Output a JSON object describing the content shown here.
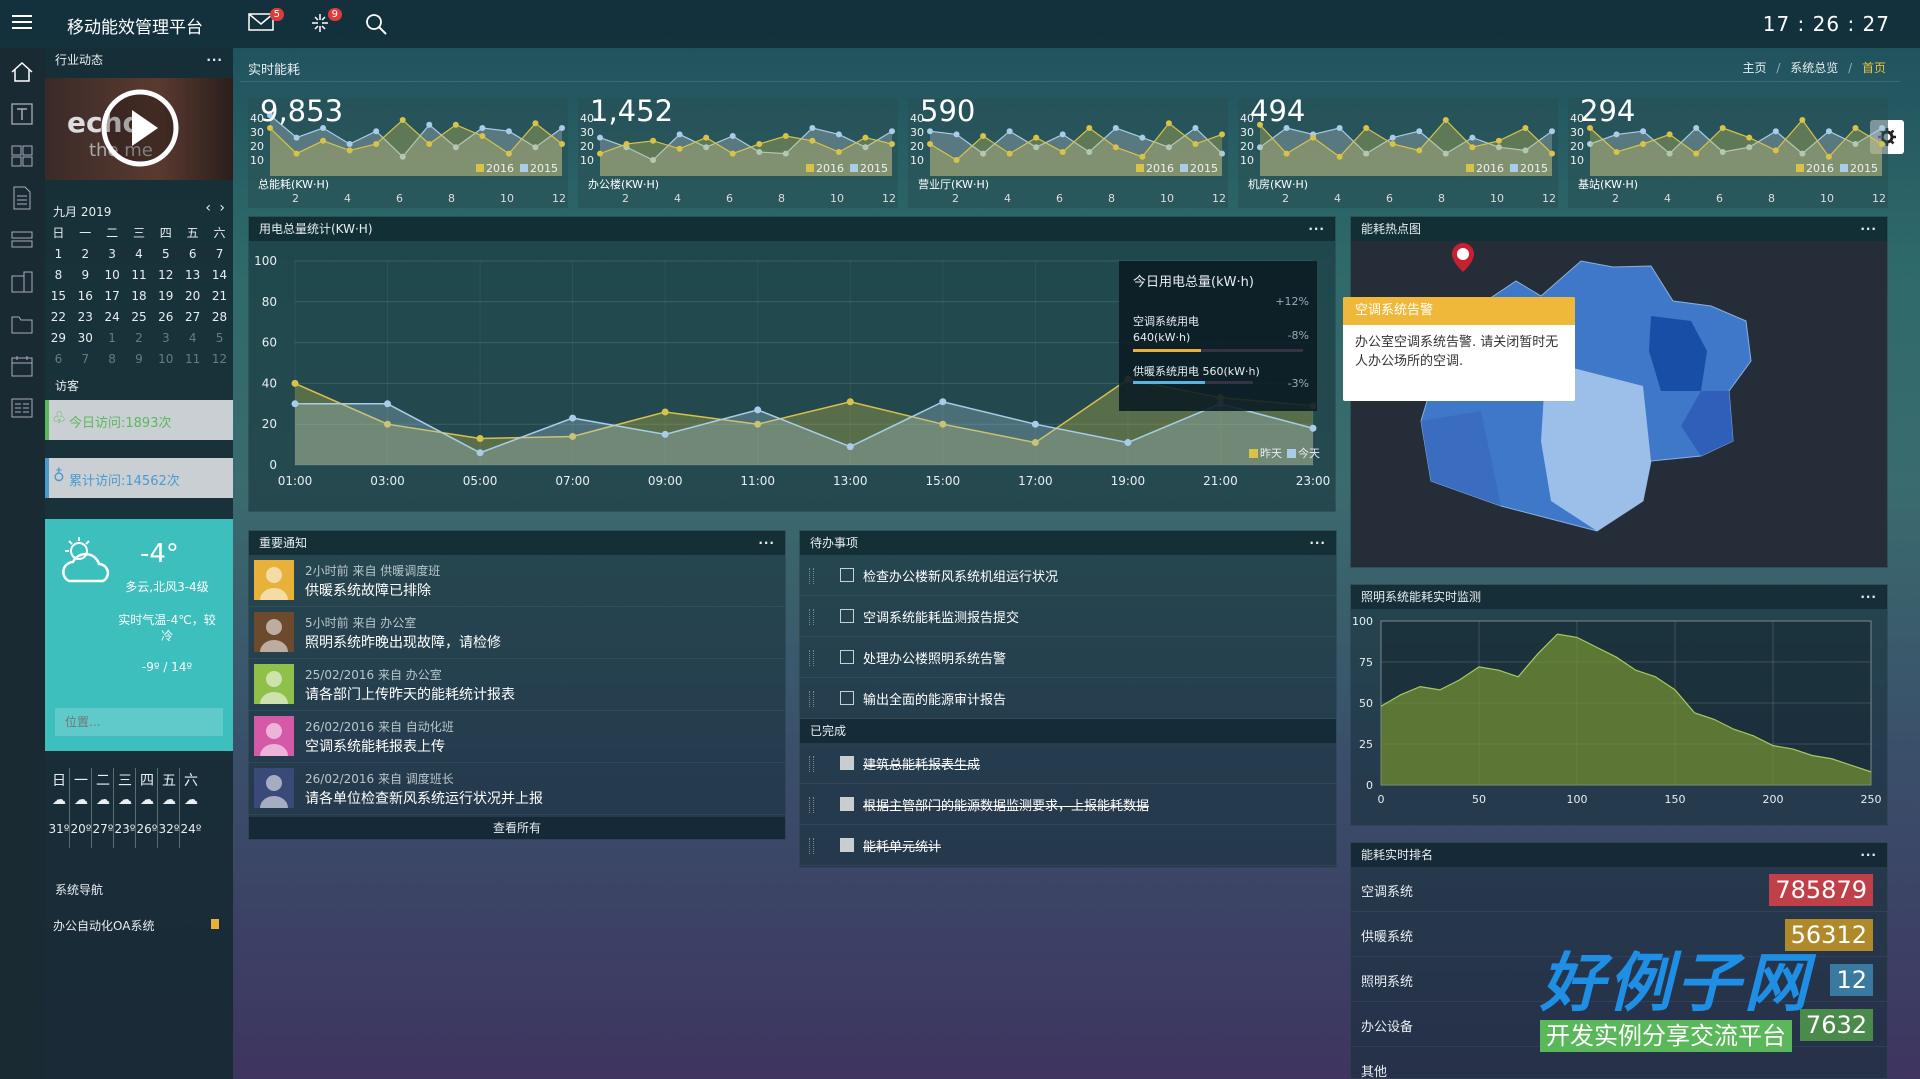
{
  "app": {
    "title": "移动能效管理平台",
    "clock": "17 : 26 : 27",
    "mail_badge": "5",
    "plug_badge": "9"
  },
  "header": {
    "section_title": "实时能耗",
    "breadcrumb": [
      "主页",
      "系统总览",
      "首页"
    ]
  },
  "sidebar": {
    "news_title": "行业动态",
    "video_text": "echo",
    "video_sub": "the me",
    "calendar": {
      "month": "九月 2019",
      "weekdays": [
        "日",
        "一",
        "二",
        "三",
        "四",
        "五",
        "六"
      ],
      "rows": [
        [
          "1",
          "2",
          "3",
          "4",
          "5",
          "6",
          "7"
        ],
        [
          "8",
          "9",
          "10",
          "11",
          "12",
          "13",
          "14"
        ],
        [
          "15",
          "16",
          "17",
          "18",
          "19",
          "20",
          "21"
        ],
        [
          "22",
          "23",
          "24",
          "25",
          "26",
          "27",
          "28"
        ],
        [
          "29",
          "30",
          "1",
          "2",
          "3",
          "4",
          "5"
        ],
        [
          "6",
          "7",
          "8",
          "9",
          "10",
          "11",
          "12"
        ]
      ]
    },
    "visitors_title": "访客",
    "today_visits": "今日访问:1893次",
    "total_visits": "累计访问:14562次",
    "weather": {
      "temp": "-4°",
      "desc1": "多云,北风3-4级",
      "desc2": "实时气温-4℃，较冷",
      "range": "-9º / 14º",
      "location_placeholder": "位置...",
      "week_days": [
        "日",
        "一",
        "二",
        "三",
        "四",
        "五",
        "六"
      ],
      "week_temps": [
        "31º",
        "20º",
        "27º",
        "23º",
        "26º",
        "32º",
        "24º"
      ]
    },
    "nav_title": "系统导航",
    "nav_item": "办公自动化OA系统"
  },
  "kpis": [
    {
      "value": "9,853",
      "label": "总能耗(KW·H)"
    },
    {
      "value": "1,452",
      "label": "办公楼(KW·H)"
    },
    {
      "value": "590",
      "label": "营业厅(KW·H)"
    },
    {
      "value": "494",
      "label": "机房(KW·H)"
    },
    {
      "value": "294",
      "label": "基站(KW·H)"
    }
  ],
  "kpi_legend": [
    "2016",
    "2015"
  ],
  "kpi_yticks": [
    "40",
    "30",
    "20",
    "10"
  ],
  "kpi_xticks": [
    "2",
    "4",
    "6",
    "8",
    "10",
    "12"
  ],
  "main_chart": {
    "title": "用电总量统计(KW·H)",
    "tooltip": {
      "title": "今日用电总量(kW·h)",
      "pct1": "+12%",
      "ac_label": "空调系统用电",
      "ac_value": "640(kW·h)",
      "pct2": "-8%",
      "heat_label": "供暖系统用电 560(kW·h)",
      "pct3": "-3%"
    }
  },
  "chart_data": [
    {
      "type": "line",
      "title": "用电总量统计(KW·H)",
      "x": [
        "01:00",
        "03:00",
        "05:00",
        "07:00",
        "09:00",
        "11:00",
        "13:00",
        "15:00",
        "17:00",
        "19:00",
        "21:00",
        "23:00"
      ],
      "series": [
        {
          "name": "昨天",
          "values": [
            40,
            20,
            13,
            14,
            26,
            20,
            31,
            20,
            11,
            42,
            33,
            29
          ]
        },
        {
          "name": "今天",
          "values": [
            30,
            30,
            6,
            23,
            15,
            27,
            9,
            31,
            20,
            11,
            30,
            18
          ]
        }
      ],
      "ylim": [
        0,
        100
      ],
      "yticks": [
        "100",
        "80",
        "60",
        "40",
        "20",
        "0"
      ],
      "colors": [
        "#d8c24a",
        "#a9cde8"
      ]
    },
    {
      "type": "area",
      "title": "照明系统能耗实时监测",
      "xlim": [
        0,
        250
      ],
      "ylim": [
        0,
        100
      ],
      "xticks": [
        "0",
        "50",
        "100",
        "150",
        "200",
        "250"
      ],
      "yticks": [
        "100",
        "75",
        "50",
        "25",
        "0"
      ],
      "x": [
        0,
        10,
        20,
        30,
        40,
        50,
        60,
        70,
        80,
        90,
        100,
        110,
        120,
        130,
        140,
        150,
        160,
        170,
        180,
        190,
        200,
        210,
        220,
        230,
        240,
        250
      ],
      "values": [
        48,
        55,
        60,
        58,
        64,
        72,
        70,
        66,
        80,
        92,
        90,
        84,
        78,
        70,
        66,
        58,
        44,
        40,
        34,
        30,
        24,
        22,
        18,
        16,
        12,
        8
      ]
    }
  ],
  "heatmap": {
    "title": "能耗热点图",
    "alert_title": "空调系统告警",
    "alert_text": "办公室空调系统告警. 请关闭暂时无人办公场所的空调."
  },
  "lighting": {
    "title": "照明系统能耗实时监测"
  },
  "notices": {
    "title": "重要通知",
    "more": "查看所有",
    "items": [
      {
        "meta": "2小时前 来自 供暖调度班",
        "msg": "供暖系统故障已排除",
        "color": "#e8b23a"
      },
      {
        "meta": "5小时前 来自 办公室",
        "msg": "照明系统昨晚出现故障，请检修",
        "color": "#6b4a2e"
      },
      {
        "meta": "25/02/2016 来自 办公室",
        "msg": "请各部门上传昨天的能耗统计报表",
        "color": "#8fc14a"
      },
      {
        "meta": "26/02/2016 来自 自动化班",
        "msg": "空调系统能耗报表上传",
        "color": "#d45aa8"
      },
      {
        "meta": "26/02/2016 来自 调度班长",
        "msg": "请各单位检查新风系统运行状况并上报",
        "color": "#3a4a78"
      }
    ]
  },
  "todos": {
    "title": "待办事项",
    "done_title": "已完成",
    "pending": [
      "检查办公楼新风系统机组运行状况",
      "空调系统能耗监测报告提交",
      "处理办公楼照明系统告警",
      "输出全面的能源审计报告"
    ],
    "done": [
      "建筑总能耗报表生成",
      "根据主管部门的能源数据监测要求，上报能耗数据",
      "能耗单元统计"
    ]
  },
  "ranking": {
    "title": "能耗实时排名",
    "items": [
      {
        "name": "空调系统",
        "value": "785879",
        "color": "#c0404a"
      },
      {
        "name": "供暖系统",
        "value": "56312",
        "color": "#b08a2a"
      },
      {
        "name": "照明系统",
        "value": "12",
        "color": "#3a7aa0"
      },
      {
        "name": "办公设备",
        "value": "7632",
        "color": "#4a8a4a"
      },
      {
        "name": "其他",
        "value": "",
        "color": "#3a6a50"
      }
    ]
  },
  "watermark": {
    "title": "好例子网",
    "subtitle": "开发实例分享交流平台"
  }
}
